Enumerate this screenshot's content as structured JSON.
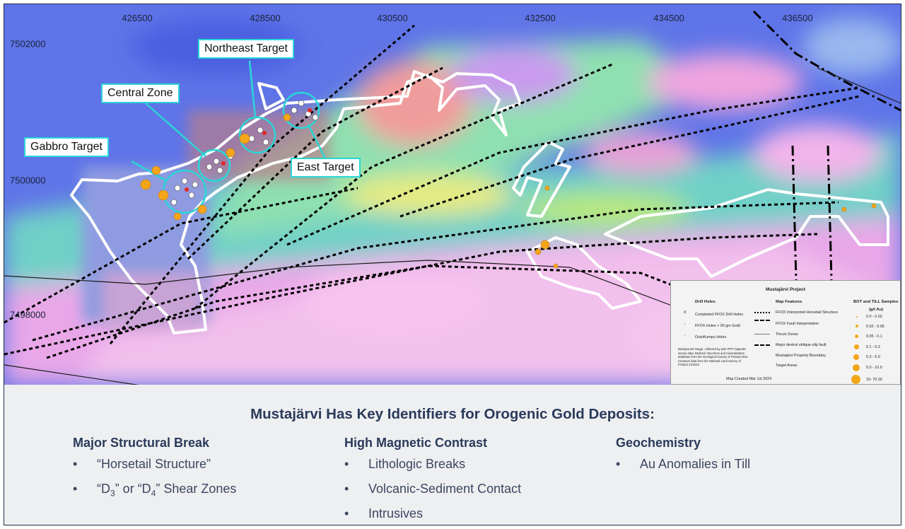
{
  "map": {
    "x_ticks": [
      "426500",
      "428500",
      "430500",
      "432500",
      "434500",
      "436500"
    ],
    "y_ticks": [
      "7502000",
      "7500000",
      "7498000"
    ],
    "callouts": {
      "northeast": "Northeast Target",
      "central": "Central Zone",
      "gabbro": "Gabbro Target",
      "east": "East Target"
    },
    "colors": {
      "callout_border": "#2ad6d6",
      "structure_line": "#000000",
      "property_boundary": "#ffffff",
      "sample_marker": "#f3a619"
    }
  },
  "legend": {
    "title": "Mustajärvi Project",
    "drill_holes": {
      "heading": "Drill Holes",
      "items": [
        "Completed FFOX Drill Holes",
        "FFOX Holes > 90 gm Gold",
        "OutoKumpu Holes"
      ]
    },
    "map_features": {
      "heading": "Map Features",
      "items": [
        "FFOX Interpreted Horsetail Structure",
        "FFOX Fault Interpretation",
        "Thrust Zones",
        "Major dextral oblique-slip fault",
        "Mustajärvi Property Boundary",
        "Target Areas"
      ]
    },
    "samples": {
      "heading": "BOT and TILL Samples",
      "unit": "(g/t Au)",
      "items": [
        "0.0 - 0.02",
        "0.02 - 0.05",
        "0.05 - 0.1",
        "0.1 - 0.3",
        "0.3 - 5.0",
        "5.0 - 10.0",
        "10- 70.30"
      ]
    },
    "note": "Background Image: collected by pole RTP magnetic survey data. Bedrock structures and mineralization database from the Geological Survey of Finland 2011. Contours data from the National Land Survey of Finland 12/2022",
    "created": "Map Created Mar 1st 2024"
  },
  "panel": {
    "title": "Mustajärvi Has Key Identifiers for Orogenic Gold Deposits:",
    "columns": [
      {
        "heading": "Major Structural Break",
        "items": [
          "“Horsetail Structure”"
        ]
      },
      {
        "heading": "High Magnetic Contrast",
        "items": [
          "Lithologic Breaks",
          "Volcanic-Sediment Contact",
          "Intrusives"
        ]
      },
      {
        "heading": "Geochemistry",
        "items": [
          "Au Anomalies in Till"
        ]
      }
    ],
    "shear": {
      "prefix": "“D",
      "sub1": "3",
      "mid": "” or “D",
      "sub2": "4",
      "suffix": "” Shear Zones"
    }
  }
}
